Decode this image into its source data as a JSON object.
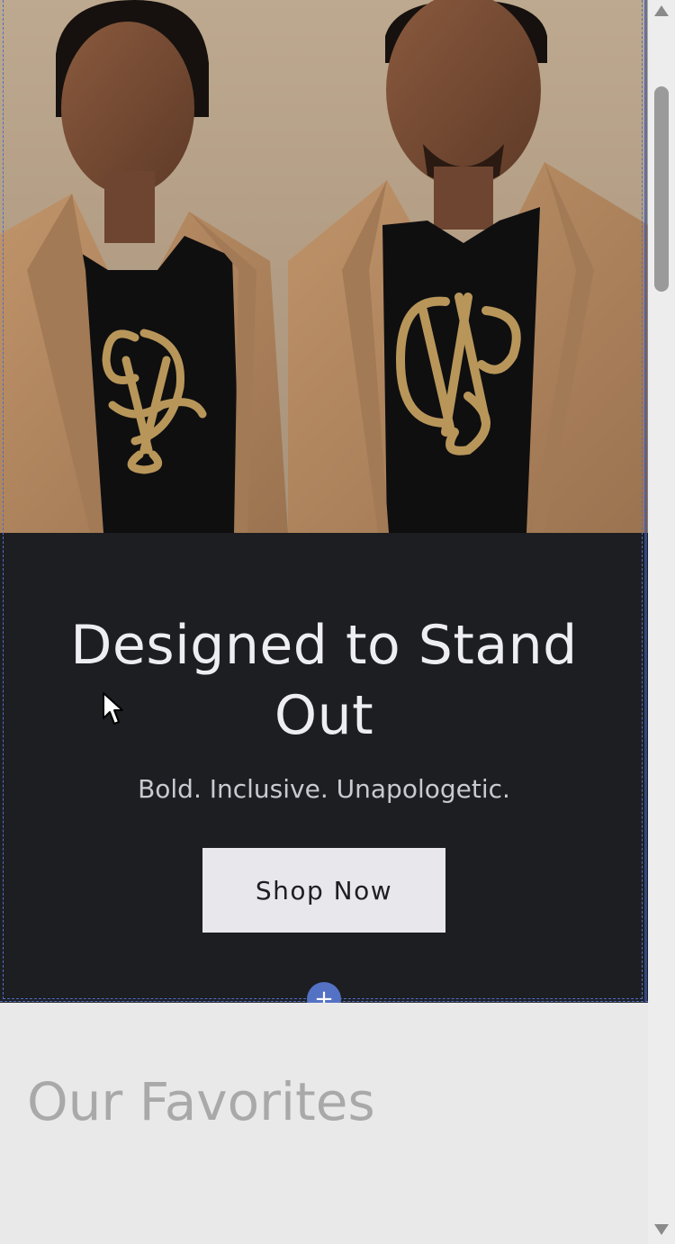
{
  "hero": {
    "image": {
      "icon": "hero-photo",
      "jacket_color": "#b58a62",
      "shirt_color": "#0f0f10",
      "emblem_color": "#b8965a",
      "backdrop_color": "#b9a58c"
    },
    "heading": "Designed to Stand Out",
    "tagline": "Bold. Inclusive. Unapologetic.",
    "cta_label": "Shop Now",
    "background_color": "#1d1e22"
  },
  "editor": {
    "add_section_icon": "plus-icon",
    "add_section_label": "+",
    "accent_color": "#5472c4"
  },
  "favorites": {
    "title": "Our Favorites"
  },
  "scrollbar": {
    "up_icon": "chevron-up-icon",
    "down_icon": "chevron-down-icon"
  }
}
